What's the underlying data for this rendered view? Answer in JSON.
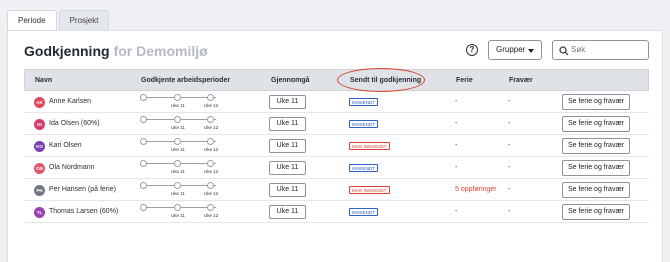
{
  "tabs": [
    {
      "label": "Periode",
      "active": true
    },
    {
      "label": "Prosjekt",
      "active": false
    }
  ],
  "header": {
    "title": "Godkjenning",
    "subtitle": "for Demomiljø",
    "help_label": "?",
    "groups_label": "Grupper",
    "search_placeholder": "Søk"
  },
  "table": {
    "columns": {
      "name": "Navn",
      "periods": "Godkjente arbeidsperioder",
      "review": "Gjennomgå",
      "submitted": "Sendt til godkjenning",
      "vacation": "Ferie",
      "absence": "Fravær"
    },
    "step_labels": [
      "Uke 11",
      "Uke 12"
    ],
    "rows": [
      {
        "initials": "AK",
        "name": "Anne Karlsen",
        "avatar_color": "#e0475c",
        "review": "Uke 11",
        "status": "INNSENDT",
        "status_type": "sent",
        "vacation": "-",
        "absence": "-",
        "action": "Se ferie og fravær"
      },
      {
        "initials": "IO",
        "name": "Ida Olsen (60%)",
        "avatar_color": "#d63a6e",
        "review": "Uke 11",
        "status": "INNSENDT",
        "status_type": "sent",
        "vacation": "-",
        "absence": "-",
        "action": "Se ferie og fravær"
      },
      {
        "initials": "KO",
        "name": "Kari Olsen",
        "avatar_color": "#7a3fb0",
        "review": "Uke 11",
        "status": "IKKE INNSENDT",
        "status_type": "notsent",
        "vacation": "-",
        "absence": "-",
        "action": "Se ferie og fravær"
      },
      {
        "initials": "ON",
        "name": "Ola Nordmann",
        "avatar_color": "#e0566f",
        "review": "Uke 11",
        "status": "INNSENDT",
        "status_type": "sent",
        "vacation": "-",
        "absence": "-",
        "action": "Se ferie og fravær"
      },
      {
        "initials": "PH",
        "name": "Per Hansen (på ferie)",
        "avatar_color": "#6f7680",
        "review": "Uke 11",
        "status": "IKKE INNSENDT",
        "status_type": "notsent",
        "vacation": "5 oppføringer",
        "vacation_warn": true,
        "absence": "-",
        "action": "Se ferie og fravær"
      },
      {
        "initials": "TL",
        "name": "Thomas Larsen (60%)",
        "avatar_color": "#9b3fb4",
        "review": "Uke 11",
        "status": "INNSENDT",
        "status_type": "sent",
        "vacation": "-",
        "absence": "-",
        "action": "Se ferie og fravær"
      }
    ]
  },
  "colors": {
    "accent_red": "#d8452f",
    "status_blue": "#2f5fc4"
  }
}
